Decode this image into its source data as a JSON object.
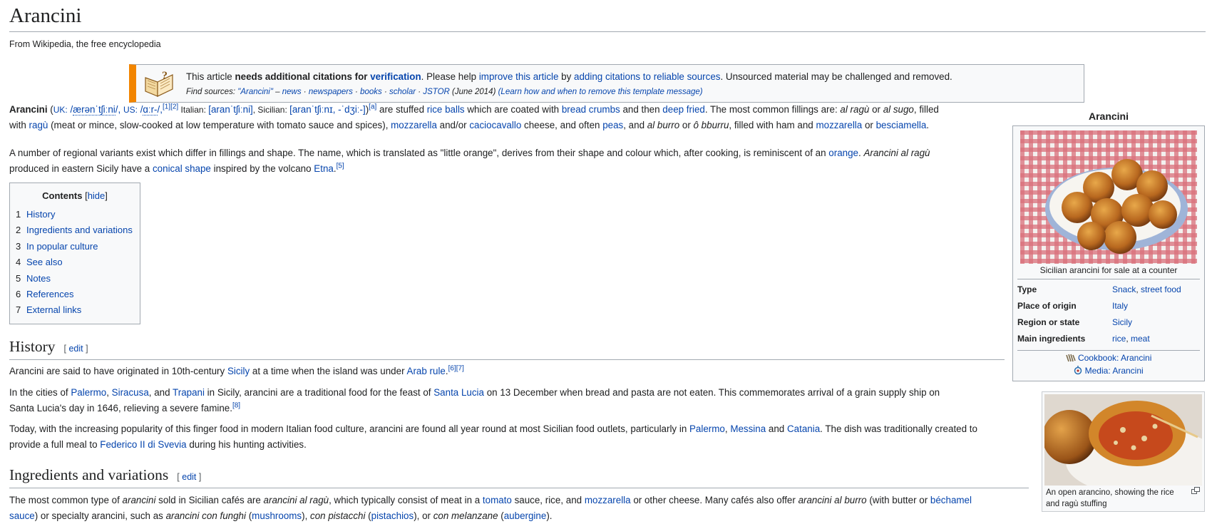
{
  "page": {
    "title": "Arancini",
    "tagline": "From Wikipedia, the free encyclopedia"
  },
  "ambox": {
    "icon": "book-question-icon",
    "t1": "This article ",
    "t2": "needs additional citations for ",
    "t3": "verification",
    "t4": ". Please help ",
    "t5": "improve this article",
    "t6": " by ",
    "t7": "adding citations to reliable sources",
    "t8": ". Unsourced material may be challenged and removed.",
    "f1": "Find sources: ",
    "f2": "\"Arancini\"",
    "f3": " – ",
    "f4": "news",
    "f5": " · ",
    "f6": "newspapers",
    "f7": "books",
    "f8": "scholar",
    "f9": "JSTOR",
    "f10": " (June 2014) ",
    "f11": "(Learn how and when to remove this template message)"
  },
  "lead": {
    "p1": {
      "a": "Arancini",
      "b": " (",
      "c": "UK:",
      "d": " /",
      "e": "ærənˈtʃiːni",
      "f": "/, ",
      "g": "US:",
      "h": " /",
      "i": "ɑːr-",
      "j": "/,",
      "k": "[1][2]",
      "l": " Italian: ",
      "m": "[aranˈtʃiːni]",
      "n": ", Sicilian: ",
      "o": "[aranˈtʃiːnɪ, -ˈdʒiː-]",
      "p": ")",
      "q": "[a]",
      "r": " are stuffed ",
      "s": "rice balls",
      "t": " which are coated with ",
      "u": "bread crumbs",
      "v": " and then ",
      "w": "deep fried",
      "x": ". The most common fillings are: ",
      "y": "al ragù",
      "z": " or ",
      "aa": "al sugo",
      "ab": ", filled"
    },
    "p1b": {
      "a": "with ",
      "b": "ragù",
      "c": " (meat or mince, slow-cooked at low temperature with tomato sauce and spices), ",
      "d": "mozzarella",
      "e": " and/or ",
      "f": "caciocavallo",
      "g": " cheese, and often ",
      "h": "peas",
      "i": ", and ",
      "j": "al burro",
      "k": " or ",
      "l": "ô bburru",
      "m": ", filled with ham and ",
      "n": "mozzarella",
      "o": " or ",
      "p": "besciamella",
      "q": "."
    },
    "p2": {
      "a": "A number of regional variants exist which differ in fillings and shape. The name, which is translated as \"little orange\", derives from their shape and colour which, after cooking, is reminiscent of an ",
      "b": "orange",
      "c": ". ",
      "d": "Arancini al ragù"
    },
    "p2b": {
      "a": "produced in eastern Sicily have a ",
      "b": "conical shape",
      "c": " inspired by the volcano ",
      "d": "Etna",
      "e": ".",
      "f": "[5]"
    }
  },
  "toc": {
    "title": "Contents",
    "hide_open": " [",
    "hide": "hide",
    "hide_close": "]",
    "items": [
      {
        "num": "1",
        "label": "History"
      },
      {
        "num": "2",
        "label": "Ingredients and variations"
      },
      {
        "num": "3",
        "label": "In popular culture"
      },
      {
        "num": "4",
        "label": "See also"
      },
      {
        "num": "5",
        "label": "Notes"
      },
      {
        "num": "6",
        "label": "References"
      },
      {
        "num": "7",
        "label": "External links"
      }
    ]
  },
  "history": {
    "heading": "History",
    "edit_open": "[ ",
    "edit": "edit",
    "edit_close": " ]",
    "p1": {
      "a": "Arancini are said to have originated in 10th-century ",
      "b": "Sicily",
      "c": " at a time when the island was under ",
      "d": "Arab rule",
      "e": ".",
      "f": "[6][7]"
    },
    "p2": {
      "a": "In the cities of ",
      "b": "Palermo",
      "c": ", ",
      "d": "Siracusa",
      "e": ", and ",
      "f": "Trapani",
      "g": " in Sicily, arancini are a traditional food for the feast of ",
      "h": "Santa Lucia",
      "i": " on 13 December when bread and pasta are not eaten. This commemorates arrival of a grain supply ship on"
    },
    "p2b": {
      "a": "Santa Lucia's day in 1646, relieving a severe famine.",
      "b": "[8]"
    },
    "p3": {
      "a": "Today, with the increasing popularity of this finger food in modern Italian food culture, arancini are found all year round at most Sicilian food outlets, particularly in ",
      "b": "Palermo",
      "c": ", ",
      "d": "Messina",
      "e": " and ",
      "f": "Catania",
      "g": ". The dish was traditionally created to"
    },
    "p3b": {
      "a": "provide a full meal to ",
      "b": "Federico II di Svevia",
      "c": " during his hunting activities."
    }
  },
  "ingredients": {
    "heading": "Ingredients and variations",
    "edit_open": "[ ",
    "edit": "edit",
    "edit_close": " ]",
    "p1": {
      "a": "The most common type of ",
      "b": "arancini",
      "c": " sold in Sicilian cafés are ",
      "d": "arancini al ragù",
      "e": ", which typically consist of meat in a ",
      "f": "tomato",
      "g": " sauce, rice, and ",
      "h": "mozzarella",
      "i": " or other cheese. Many cafés also offer ",
      "j": "arancini al burro",
      "k": " (with butter or ",
      "l": "béchamel"
    },
    "p1b": {
      "a": "sauce",
      "b": ") or specialty arancini, such as ",
      "c": "arancini con funghi",
      "d": " (",
      "e": "mushrooms",
      "f": "), ",
      "g": "con pistacchi",
      "h": " (",
      "i": "pistachios",
      "j": "), or ",
      "k": "con melanzane",
      "l": " (",
      "m": "aubergine",
      "n": ")."
    }
  },
  "infobox": {
    "caption": "Arancini",
    "image_caption": "Sicilian arancini for sale at a counter",
    "rows": [
      {
        "key": "Type",
        "v1": "Snack",
        "sep": ", ",
        "v2": "street food"
      },
      {
        "key": "Place of origin",
        "v1": "Italy"
      },
      {
        "key": "Region or state",
        "v1": "Sicily"
      },
      {
        "key": "Main ingredients",
        "v1": "rice",
        "sep": ", ",
        "v2": "meat"
      }
    ],
    "cookbook": "Cookbook: Arancini",
    "media": "Media: Arancini"
  },
  "thumb": {
    "caption": "An open arancino, showing the rice and ragù stuffing"
  },
  "colors": {
    "link": "#0645ad",
    "ambox_accent": "#f28500",
    "rule": "#a2a9b1"
  }
}
